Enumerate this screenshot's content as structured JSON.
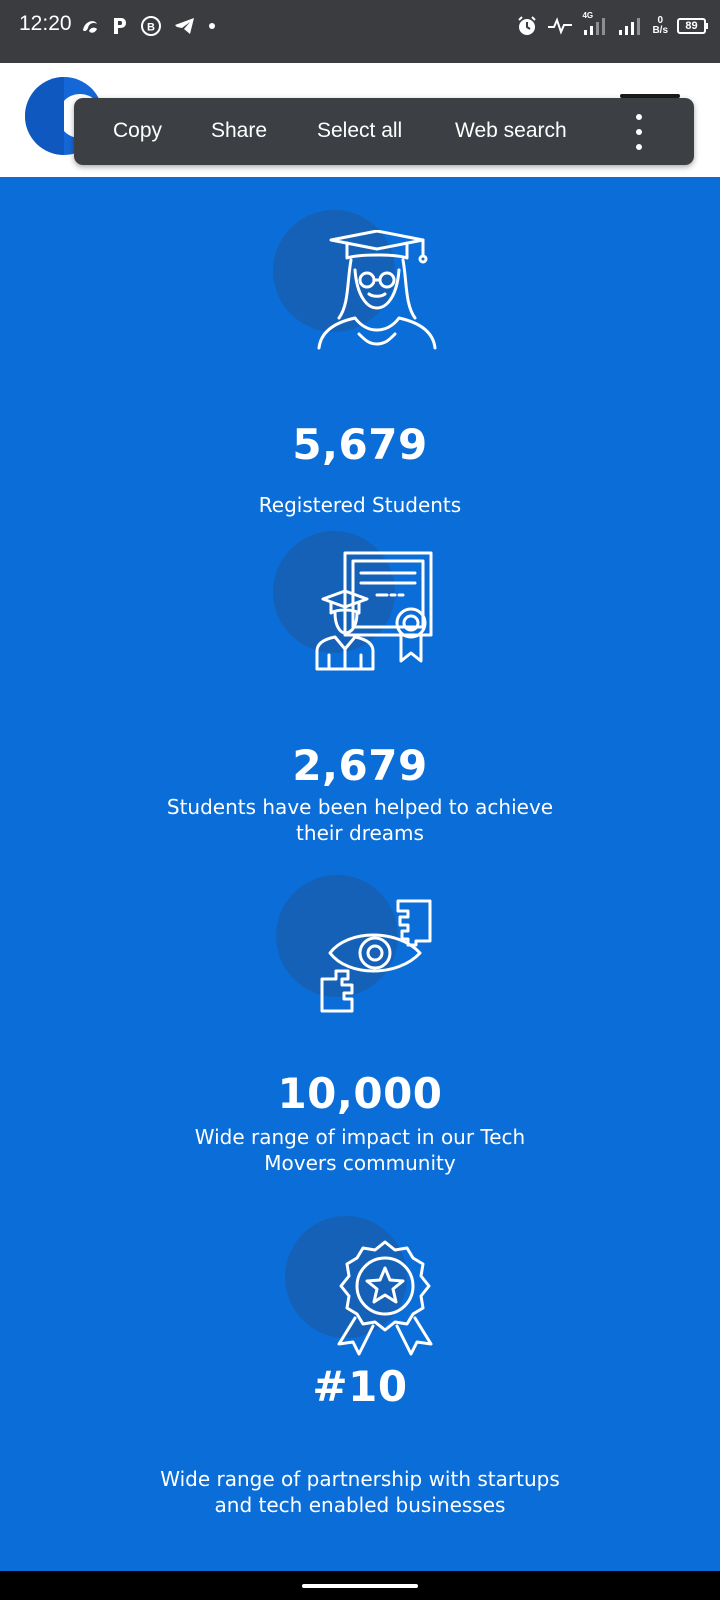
{
  "status_bar": {
    "time": "12:20",
    "left_icons": [
      "swirl-icon",
      "p-icon",
      "b-circle-icon",
      "telegram-icon",
      "dot-icon"
    ],
    "network_type": "4G",
    "speed_value": "0",
    "speed_unit": "B/s",
    "battery": "89"
  },
  "header": {
    "logo": "brand-logo",
    "menu_icon": "hamburger-icon"
  },
  "selection_toolbar": {
    "copy": "Copy",
    "share": "Share",
    "select_all": "Select all",
    "web_search": "Web search",
    "more_icon": "more-vertical-icon"
  },
  "stats": [
    {
      "icon": "graduate-icon",
      "value": "5,679",
      "label": "Registered Students"
    },
    {
      "icon": "certificate-icon",
      "value": "2,679",
      "label": "Students have been helped to achieve their dreams"
    },
    {
      "icon": "vision-icon",
      "value": "10,000",
      "label": "Wide range of impact in our Tech Movers community"
    },
    {
      "icon": "award-badge-icon",
      "value": "#10",
      "label": "Wide range of partnership with startups and tech enabled businesses"
    }
  ],
  "colors": {
    "background": "#0b6ed8",
    "icon_circle": "#1561b8",
    "status_bar": "#3a3c40",
    "toolbar": "#3c3f43"
  }
}
